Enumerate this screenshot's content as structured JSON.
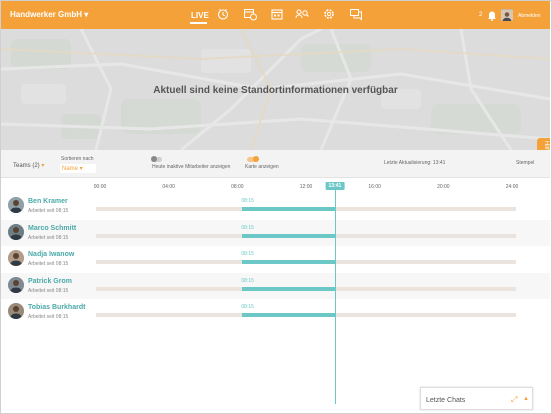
{
  "header": {
    "company": "Handwerker GmbH ▾",
    "live_label": "LIVE",
    "notification_count": "2",
    "user_name": "Abmelden"
  },
  "map": {
    "message": "Aktuell sind keine Standortinformationen verfügbar"
  },
  "help": {
    "label": "Hilfe"
  },
  "controls": {
    "teams_label": "Teams (2)",
    "teams_caret": "▾",
    "sort_label": "Sortieren nach",
    "sort_value": "Name ▾",
    "toggle_inactive_label": "Heute inaktive Mitarbeiter anzeigen",
    "toggle_inactive_on": false,
    "toggle_map_label": "Karte anzeigen",
    "toggle_map_on": true,
    "last_update": "Letzte Aktualisierung: 13:41",
    "stempel": "Stempel"
  },
  "timeline": {
    "ticks": [
      "00:00",
      "04:00",
      "08:00",
      "12:00",
      "16:00",
      "20:00",
      "24:00"
    ],
    "now": "13:41",
    "employees": [
      {
        "name": "Ben Kramer",
        "since": "Arbeitet seit 08:15",
        "start": "08:15"
      },
      {
        "name": "Marco Schmitt",
        "since": "Arbeitet seit 08:15",
        "start": "08:15"
      },
      {
        "name": "Nadja Iwanow",
        "since": "Arbeitet seit 08:15",
        "start": "08:15"
      },
      {
        "name": "Patrick Grom",
        "since": "Arbeitet seit 08:15",
        "start": "08:15"
      },
      {
        "name": "Tobias Burkhardt",
        "since": "Arbeitet seit 08:15",
        "start": "08:15"
      }
    ]
  },
  "chats": {
    "label": "Letzte Chats",
    "expand_icon": "⤢",
    "caret": "▲"
  },
  "colors": {
    "accent": "#f5a13a",
    "teal": "#6cc7c7"
  }
}
